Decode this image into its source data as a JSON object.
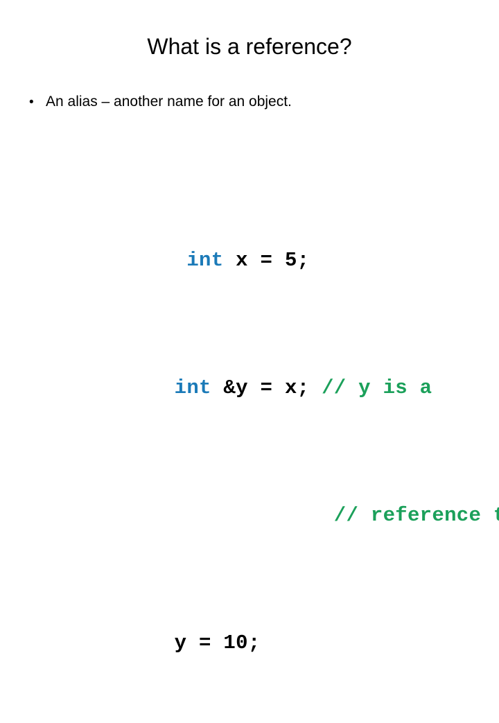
{
  "slide": {
    "title": "What is a reference?",
    "background_color": "#FFFFFF",
    "bullet": {
      "marker": "•",
      "text": "An alias – another name for an object."
    },
    "code": {
      "keyword_color": "#1B7AB8",
      "comment_color": "#1BA05A",
      "text_color": "#000000",
      "lines": [
        {
          "indent": " ",
          "keyword": "int",
          "code": " x = 5;",
          "comment": ""
        },
        {
          "indent": "",
          "keyword": "int",
          "code": " &y = x; ",
          "comment": "// y is a"
        },
        {
          "indent": "             ",
          "keyword": "",
          "code": "",
          "comment": "// reference to x"
        },
        {
          "indent": "",
          "keyword": "",
          "code": "y = 10;",
          "comment": ""
        }
      ]
    }
  }
}
